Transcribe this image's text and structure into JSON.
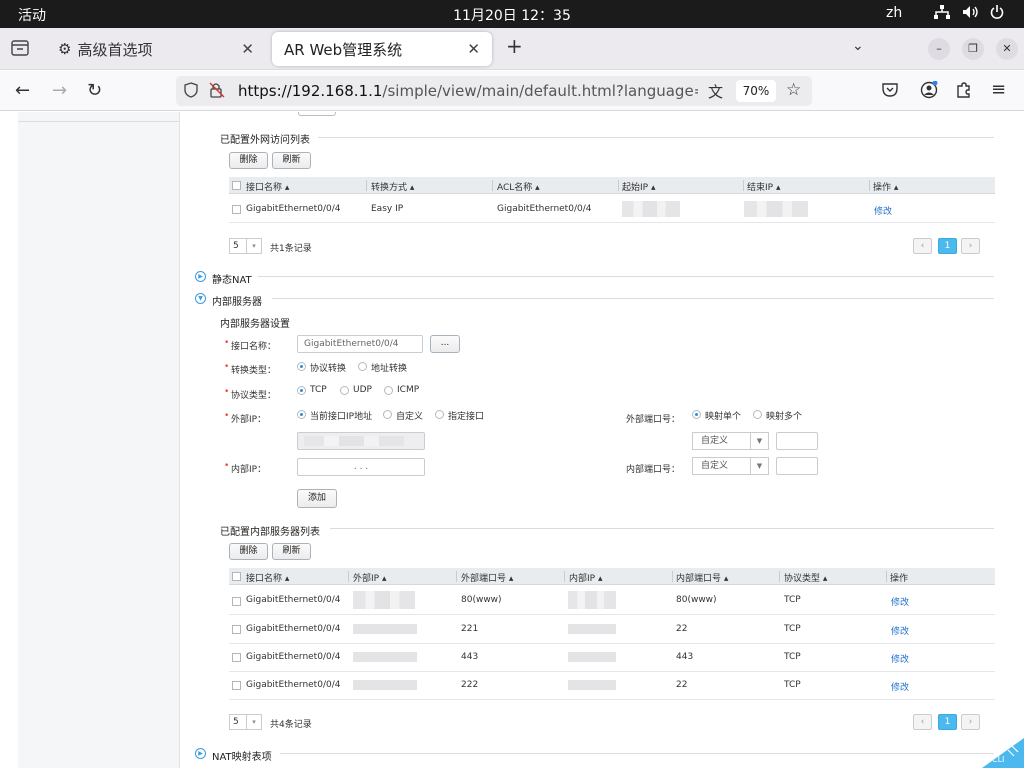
{
  "system": {
    "activities": "活动",
    "clock": "11月20日  12：35",
    "lang": "zh"
  },
  "browser": {
    "tabs": [
      {
        "label": "高级首选项",
        "icon": "gear-icon"
      },
      {
        "label": "AR Web管理系统"
      }
    ],
    "new_tab": "+",
    "url_host": "https://192.168.1.1",
    "url_path": "/simple/view/main/default.html?language=zh&",
    "zoom": "70%"
  },
  "wan_list": {
    "title": "已配置外网访问列表",
    "delete_label": "删除",
    "refresh_label": "刷新",
    "columns": [
      "接口名称",
      "转换方式",
      "ACL名称",
      "起始IP",
      "结束IP",
      "操作"
    ],
    "rows": [
      {
        "iface": "GigabitEthernet0/0/4",
        "mode": "Easy IP",
        "acl": "GigabitEthernet0/0/4",
        "op": "修改"
      }
    ],
    "page_size": "5",
    "total": "共1条记录",
    "page": "1"
  },
  "static_nat": {
    "title": "静态NAT"
  },
  "internal_server": {
    "title": "内部服务器",
    "settings_title": "内部服务器设置",
    "iface_label": "接口名称：",
    "iface_value": "GigabitEthernet0/0/4",
    "browse_label": "...",
    "conv_label": "转换类型：",
    "conv_opts": [
      "协议转换",
      "地址转换"
    ],
    "proto_label": "协议类型：",
    "proto_opts": [
      "TCP",
      "UDP",
      "ICMP"
    ],
    "ext_ip_label": "外部IP：",
    "ext_ip_opts": [
      "当前接口IP地址",
      "自定义",
      "指定接口"
    ],
    "ext_port_label": "外部端口号：",
    "ext_port_opts": [
      "映射单个",
      "映射多个"
    ],
    "ext_port_select": "自定义",
    "int_ip_label": "内部IP：",
    "int_ip_value": ".          .          .",
    "int_port_label": "内部端口号：",
    "int_port_select": "自定义",
    "add_label": "添加"
  },
  "server_list": {
    "title": "已配置内部服务器列表",
    "delete_label": "删除",
    "refresh_label": "刷新",
    "columns": [
      "接口名称",
      "外部IP",
      "外部端口号",
      "内部IP",
      "内部端口号",
      "协议类型",
      "操作"
    ],
    "rows": [
      {
        "iface": "GigabitEthernet0/0/4",
        "ext_port": "80(www)",
        "int_port": "80(www)",
        "proto": "TCP",
        "op": "修改"
      },
      {
        "iface": "GigabitEthernet0/0/4",
        "ext_port": "221",
        "int_port": "22",
        "proto": "TCP",
        "op": "修改"
      },
      {
        "iface": "GigabitEthernet0/0/4",
        "ext_port": "443",
        "int_port": "443",
        "proto": "TCP",
        "op": "修改"
      },
      {
        "iface": "GigabitEthernet0/0/4",
        "ext_port": "222",
        "int_port": "22",
        "proto": "TCP",
        "op": "修改"
      }
    ],
    "page_size": "5",
    "total": "共4条记录",
    "page": "1"
  },
  "nat_table": {
    "title": "NAT映射表项"
  },
  "cli_badge": "CLI",
  "colors": {
    "accent": "#4cb9ee",
    "link": "#1e6fc9",
    "required": "#ee4444"
  }
}
